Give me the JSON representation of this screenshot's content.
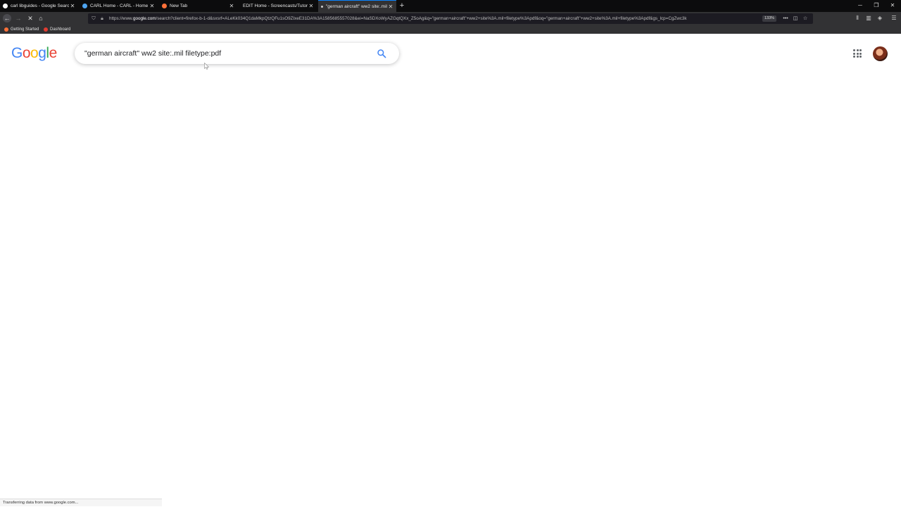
{
  "tabs": [
    {
      "title": "carl libguides - Google Search",
      "favicon_color": "#ffffff"
    },
    {
      "title": "CARL Home - CARL - Home at",
      "favicon_color": "#4ea4f0"
    },
    {
      "title": "New Tab",
      "favicon_color": "#ff7139"
    },
    {
      "title": "EDIT Home - Screencasts/Tutorials",
      "favicon_color": "#9c9c9c"
    },
    {
      "title": "\"german aircraft\" ww2 site:.mil",
      "favicon_color": "#cccccc",
      "active": true
    }
  ],
  "url": {
    "prefix": "https://www.",
    "domain": "google.com",
    "path": "/search?client=firefox-b-1-d&sxsrf=ALeKk034Q1daMkpQtzQFu1sO9ZIxeE31DA%3A1585685557028&ei=NaSDXoWyAZGqtQXx_Z5oAg&q=\"german+aircraft\"+ww2+site%3A.mil+filetype%3Apdf&oq=\"german+aircraft\"+ww2+site%3A.mil+filetype%3Apdf&gs_lcp=CgZwc3k",
    "zoom": "133%"
  },
  "bookmarks": [
    {
      "label": "Getting Started",
      "color": "#ff7139"
    },
    {
      "label": "Dashboard",
      "color": "#e03c31"
    }
  ],
  "google": {
    "logo_letters": [
      {
        "ch": "G",
        "color": "#4285F4"
      },
      {
        "ch": "o",
        "color": "#EA4335"
      },
      {
        "ch": "o",
        "color": "#FBBC05"
      },
      {
        "ch": "g",
        "color": "#4285F4"
      },
      {
        "ch": "l",
        "color": "#34A853"
      },
      {
        "ch": "e",
        "color": "#EA4335"
      }
    ],
    "query": "\"german aircraft\" ww2 site:.mil filetype:pdf"
  },
  "status_text": "Transferring data from www.google.com..."
}
